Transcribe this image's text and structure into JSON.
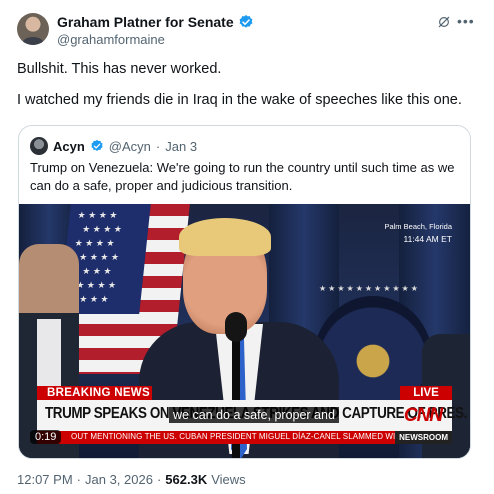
{
  "author": {
    "name": "Graham Platner for Senate",
    "handle": "@grahamformaine"
  },
  "tweet": {
    "lines": [
      "Bullshit. This has never worked.",
      "I watched my friends die in Iraq in the wake of speeches like this one."
    ]
  },
  "quoted": {
    "name": "Acyn",
    "handle": "@Acyn",
    "separator": "·",
    "date": "Jan 3",
    "text": "Trump on Venezuela: We're going to run the country until such time as we can do a safe, proper and judicious transition."
  },
  "video": {
    "location": "Palm Beach, Florida",
    "time": "11:44 AM ET",
    "breaking": "BREAKING NEWS",
    "live": "LIVE",
    "headline": "TRUMP SPEAKS ON VENEZUELA STRIKES AND CAPTURE OF PRES. MADURO",
    "network": "CNN",
    "caption": "we can do a safe, proper and",
    "ticker": "OUT MENTIONING THE US. CUBAN PRESIDENT MIGUEL DÍAZ-CANEL SLAMMED WI",
    "newsroom": "NEWSROOM",
    "duration": "0:19"
  },
  "meta": {
    "time": "12:07 PM",
    "sep1": "·",
    "date": "Jan 3, 2026",
    "sep2": "·",
    "views": "562.3K",
    "views_label": "Views"
  },
  "colors": {
    "verified": "#1d9bf0",
    "cnn_red": "#cc0000"
  },
  "icons": [
    "grok-icon",
    "more-icon",
    "verified-badge-icon"
  ]
}
